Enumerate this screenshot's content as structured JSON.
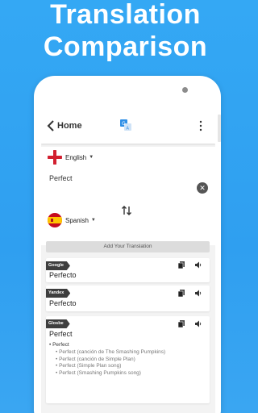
{
  "promo": {
    "line1": "Translation",
    "line2": "Comparison"
  },
  "appbar": {
    "title": "Home"
  },
  "source": {
    "language": "English",
    "text": "Perfect"
  },
  "target": {
    "language": "Spanish"
  },
  "add_translation_label": "Add Your Translation",
  "results": [
    {
      "engine": "Google",
      "text": "Perfecto"
    },
    {
      "engine": "Yandex",
      "text": "Perfecto"
    },
    {
      "engine": "Glosbe",
      "text": "Perfect"
    }
  ],
  "dictionary": {
    "head": "• Perfect",
    "items": [
      "• Perfect (canción de The Smashing Pumpkins)",
      "• Perfect (canción de Simple Plan)",
      "• Perfect (Simple Plan song)",
      "• Perfect (Smashing Pumpkins song)"
    ]
  },
  "colors": {
    "background": "#34a8f4",
    "tag": "#3e3e3e",
    "accent_translate": "#2f8fe6"
  },
  "icons": {
    "back": "chevron-left-icon",
    "translate": "translate-icon",
    "menu": "more-vertical-icon",
    "clear": "close-icon",
    "swap": "swap-vertical-icon",
    "copy": "copy-icon",
    "speak": "speaker-icon"
  }
}
